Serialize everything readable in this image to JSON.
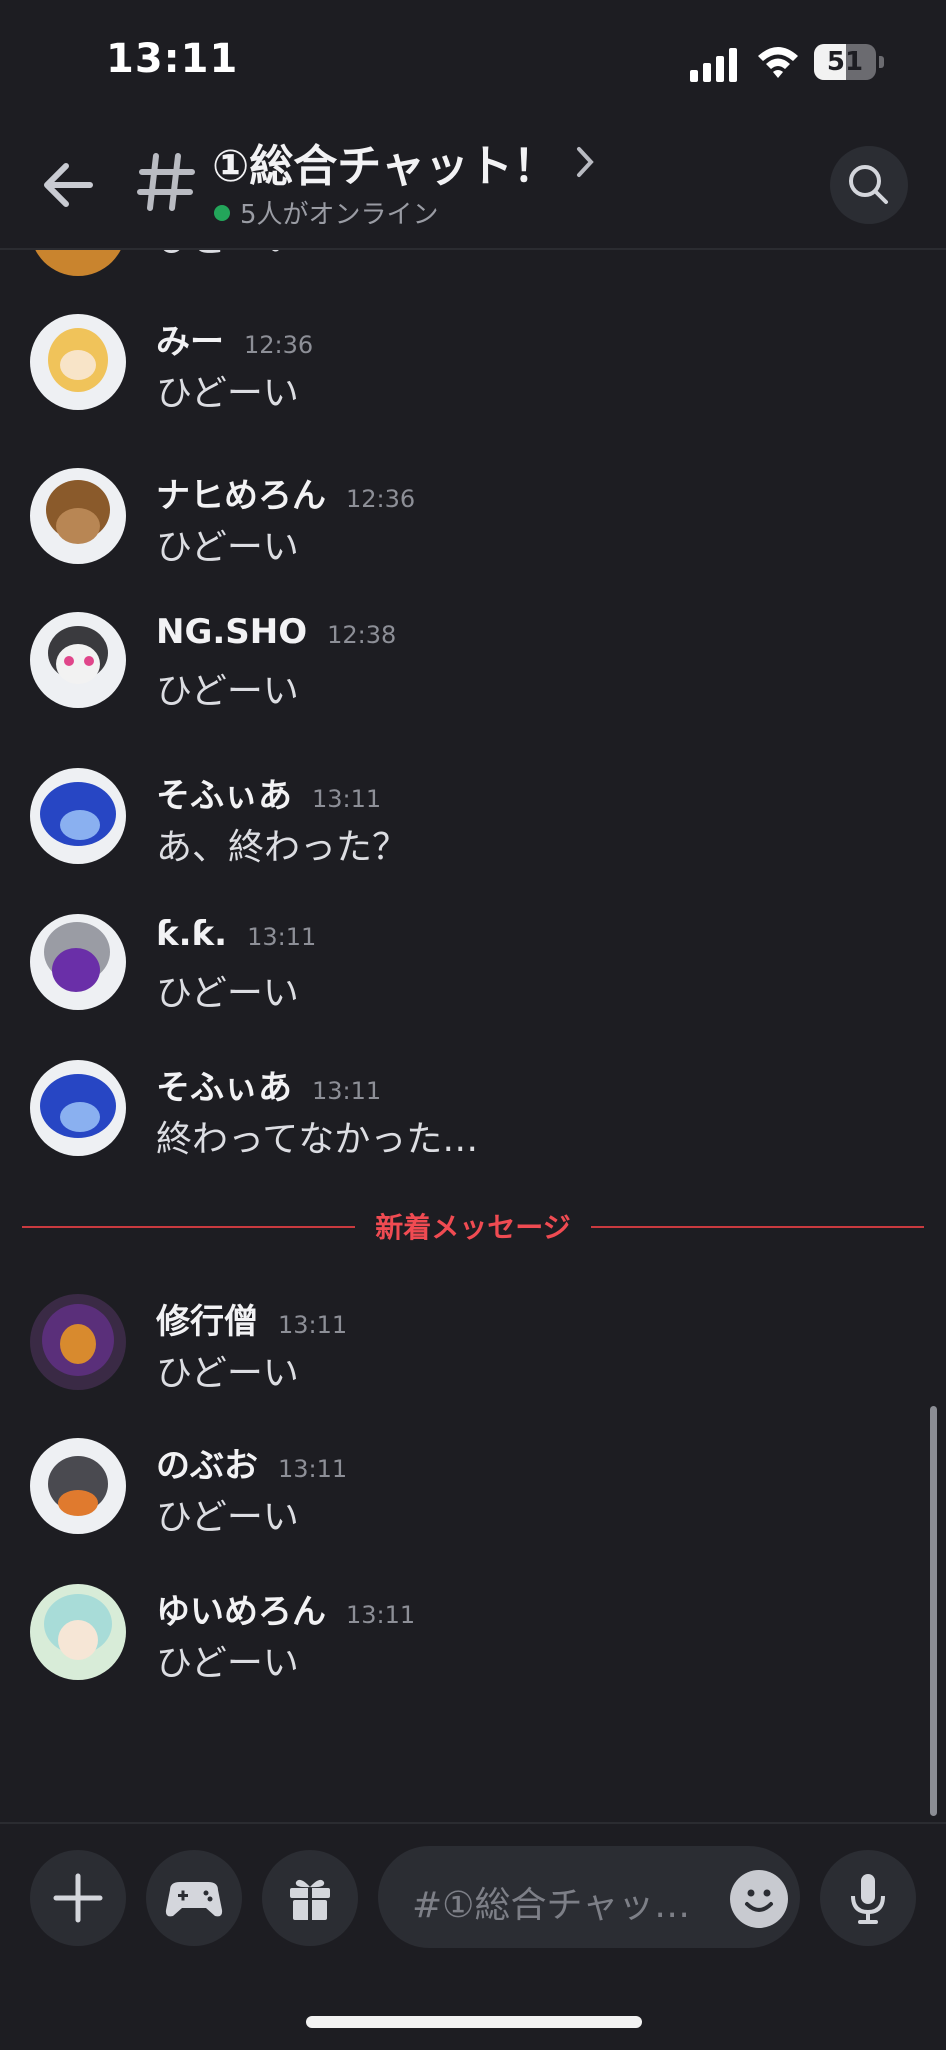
{
  "status_bar": {
    "time": "13:11",
    "battery": "51",
    "battery_level": 0.51
  },
  "header": {
    "title": "①総合チャット！",
    "online_text": "5人がオンライン",
    "back_icon": "arrow-left-icon",
    "channel_icon": "hash-icon",
    "search_icon": "search-icon"
  },
  "partial_message": {
    "text": "ひどーい"
  },
  "messages": [
    {
      "author": "みー",
      "time": "12:36",
      "text": "ひどーい"
    },
    {
      "author": "ナヒめろん",
      "time": "12:36",
      "text": "ひどーい"
    },
    {
      "author": "NG.SHO",
      "time": "12:38",
      "text": "ひどーい"
    },
    {
      "author": "そふぃあ",
      "time": "13:11",
      "text": "あ、終わった？"
    },
    {
      "author": "ƙ.ƙ.",
      "time": "13:11",
      "text": "ひどーい"
    },
    {
      "author": "そふぃあ",
      "time": "13:11",
      "text": "終わってなかった…"
    },
    {
      "author": "修行僧",
      "time": "13:11",
      "text": "ひどーい"
    },
    {
      "author": "のぶお",
      "time": "13:11",
      "text": "ひどーい"
    },
    {
      "author": "ゆいめろん",
      "time": "13:11",
      "text": "ひどーい"
    }
  ],
  "new_messages_divider": "新着メッセージ",
  "composer": {
    "placeholder": "#①総合チャッ…",
    "buttons": [
      "plus-icon",
      "gamepad-icon",
      "gift-icon",
      "emoji-icon",
      "microphone-icon"
    ]
  },
  "colors": {
    "accent_red": "#f04b52",
    "online_green": "#23a55a",
    "background": "#1d1d22"
  }
}
